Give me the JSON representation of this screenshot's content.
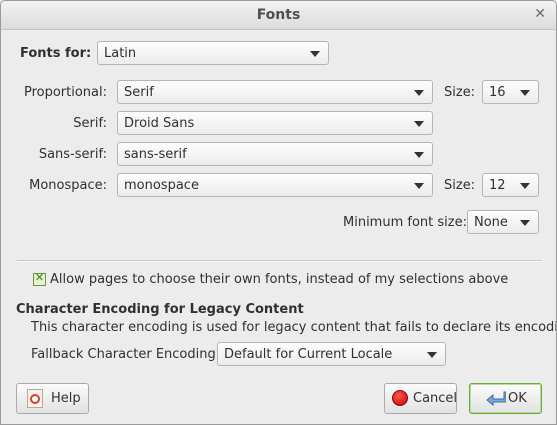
{
  "window": {
    "title": "Fonts"
  },
  "fonts_for": {
    "label": "Fonts for:",
    "value": "Latin"
  },
  "rows": {
    "proportional": {
      "label": "Proportional:",
      "value": "Serif",
      "size_label": "Size:",
      "size_value": "16"
    },
    "serif": {
      "label": "Serif:",
      "value": "Droid Sans"
    },
    "sans_serif": {
      "label": "Sans-serif:",
      "value": "sans-serif"
    },
    "monospace": {
      "label": "Monospace:",
      "value": "monospace",
      "size_label": "Size:",
      "size_value": "12"
    }
  },
  "minimum_font_size": {
    "label": "Minimum font size:",
    "value": "None"
  },
  "allow_pages": {
    "label": "Allow pages to choose their own fonts, instead of my selections above",
    "checked": true
  },
  "encoding": {
    "heading": "Character Encoding for Legacy Content",
    "description": "This character encoding is used for legacy content that fails to declare its encoding.",
    "fallback_label": "Fallback Character Encoding:",
    "fallback_value": "Default for Current Locale"
  },
  "buttons": {
    "help": "Help",
    "cancel": "Cancel",
    "ok": "OK"
  },
  "icons": {
    "close": "close-icon",
    "help": "help-icon",
    "cancel": "cancel-icon",
    "ok": "ok-icon",
    "checkbox": "checkmark-icon",
    "dropdown": "chevron-down-icon"
  },
  "colors": {
    "ok_border": "#6aaa38",
    "checkbox_check": "#3f7d13",
    "cancel_red": "#c40000"
  }
}
